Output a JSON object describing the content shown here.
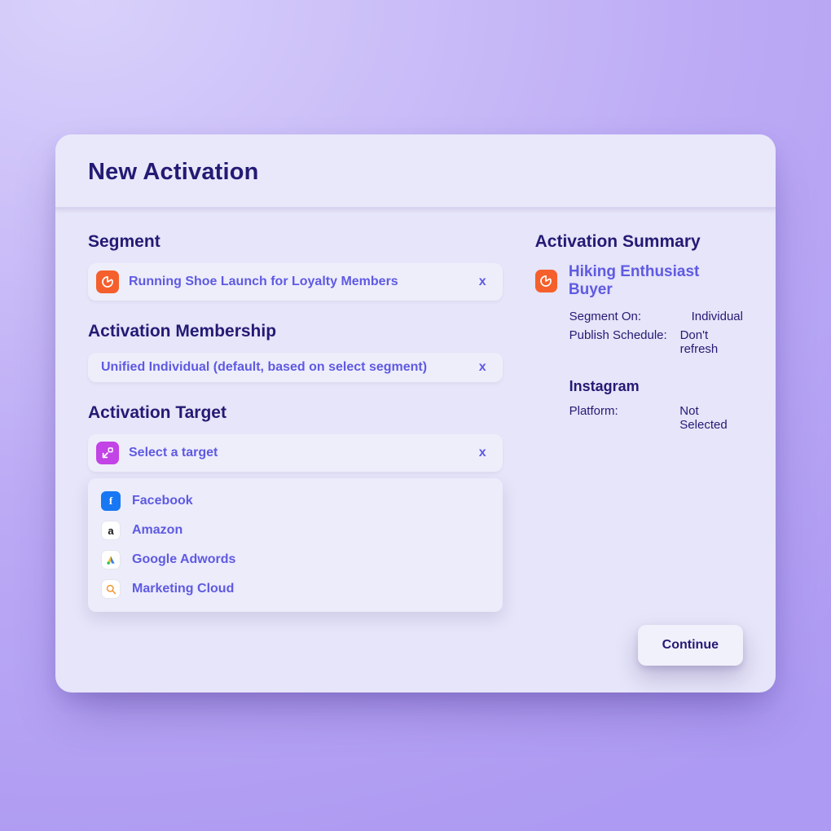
{
  "header": {
    "title": "New Activation"
  },
  "segment": {
    "label": "Segment",
    "selected": "Running Shoe Launch for Loyalty Members",
    "clear": "x"
  },
  "membership": {
    "label": "Activation Membership",
    "selected": "Unified Individual (default, based on select segment)",
    "clear": "x"
  },
  "target": {
    "label": "Activation Target",
    "placeholder": "Select a target",
    "clear": "x",
    "options": [
      {
        "name": "Facebook",
        "icon": "facebook"
      },
      {
        "name": "Amazon",
        "icon": "amazon"
      },
      {
        "name": "Google Adwords",
        "icon": "google"
      },
      {
        "name": "Marketing Cloud",
        "icon": "marketing-cloud"
      }
    ]
  },
  "summary": {
    "label": "Activation Summary",
    "title": "Hiking Enthusiast Buyer",
    "rows": [
      {
        "k": "Segment On:",
        "v": "Individual"
      },
      {
        "k": "Publish Schedule:",
        "v": "Don't refresh"
      }
    ],
    "subTitle": "Instagram",
    "subRows": [
      {
        "k": "Platform:",
        "v": "Not Selected"
      }
    ]
  },
  "actions": {
    "continue": "Continue"
  }
}
